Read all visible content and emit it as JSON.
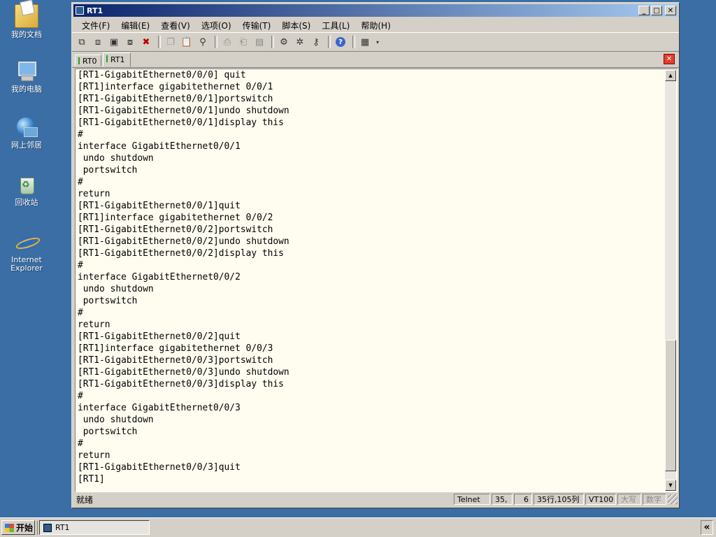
{
  "desktop": {
    "icons": [
      {
        "label": "我的文档",
        "icon": "my-documents-icon"
      },
      {
        "label": "我的电脑",
        "icon": "my-computer-icon"
      },
      {
        "label": "网上邻居",
        "icon": "network-places-icon"
      },
      {
        "label": "回收站",
        "icon": "recycle-bin-icon"
      },
      {
        "label_line1": "Internet",
        "label_line2": "Explorer",
        "icon": "internet-explorer-icon"
      }
    ]
  },
  "window": {
    "title": "RT1",
    "menu": [
      "文件(F)",
      "编辑(E)",
      "查看(V)",
      "选项(O)",
      "传输(T)",
      "脚本(S)",
      "工具(L)",
      "帮助(H)"
    ],
    "tabs": [
      {
        "label": "RT0",
        "active": false
      },
      {
        "label": "RT1",
        "active": true
      }
    ],
    "terminal_lines": [
      "[RT1-GigabitEthernet0/0/0] quit",
      "[RT1]interface gigabitethernet 0/0/1",
      "[RT1-GigabitEthernet0/0/1]portswitch",
      "[RT1-GigabitEthernet0/0/1]undo shutdown",
      "[RT1-GigabitEthernet0/0/1]display this",
      "#",
      "interface GigabitEthernet0/0/1",
      " undo shutdown",
      " portswitch",
      "#",
      "return",
      "[RT1-GigabitEthernet0/0/1]quit",
      "[RT1]interface gigabitethernet 0/0/2",
      "[RT1-GigabitEthernet0/0/2]portswitch",
      "[RT1-GigabitEthernet0/0/2]undo shutdown",
      "[RT1-GigabitEthernet0/0/2]display this",
      "#",
      "interface GigabitEthernet0/0/2",
      " undo shutdown",
      " portswitch",
      "#",
      "return",
      "[RT1-GigabitEthernet0/0/2]quit",
      "[RT1]interface gigabitethernet 0/0/3",
      "[RT1-GigabitEthernet0/0/3]portswitch",
      "[RT1-GigabitEthernet0/0/3]undo shutdown",
      "[RT1-GigabitEthernet0/0/3]display this",
      "#",
      "interface GigabitEthernet0/0/3",
      " undo shutdown",
      " portswitch",
      "#",
      "return",
      "[RT1-GigabitEthernet0/0/3]quit",
      "[RT1]"
    ],
    "status": {
      "text": "就绪",
      "protocol": "Telnet",
      "cursor_row": "35,",
      "cursor_col": "6",
      "size": "35行,105列",
      "terminal_type": "VT100",
      "caps": "大写",
      "num": "数字"
    }
  },
  "taskbar": {
    "start_label": "开始",
    "items": [
      {
        "label": "RT1"
      }
    ],
    "tray_chevron": "«"
  }
}
